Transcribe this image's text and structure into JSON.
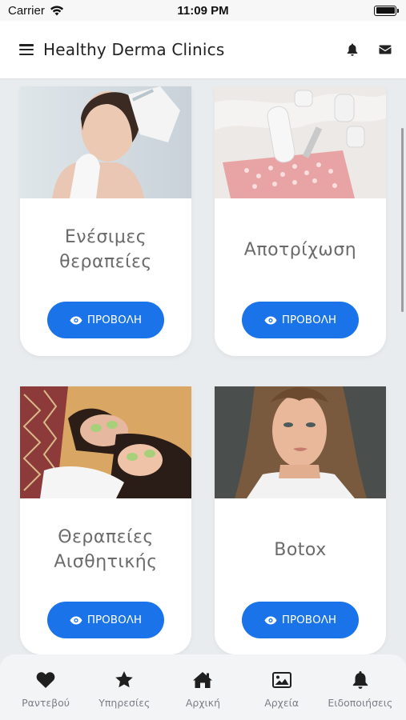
{
  "status_bar": {
    "carrier": "Carrier",
    "time": "11:09 PM"
  },
  "header": {
    "title": "Healthy Derma Clinics"
  },
  "cards": [
    {
      "title": "Ενέσιμες θεραπείες",
      "button_label": "ΠΡΟΒΟΛΗ"
    },
    {
      "title": "Αποτρίχωση",
      "button_label": "ΠΡΟΒΟΛΗ"
    },
    {
      "title": "Θεραπείες Αισθητικής",
      "button_label": "ΠΡΟΒΟΛΗ"
    },
    {
      "title": "Botox",
      "button_label": "ΠΡΟΒΟΛΗ"
    }
  ],
  "bottom_nav": [
    {
      "label": "Ραντεβού",
      "icon": "heart-icon"
    },
    {
      "label": "Υπηρεσίες",
      "icon": "star-icon"
    },
    {
      "label": "Αρχική",
      "icon": "home-icon"
    },
    {
      "label": "Αρχεία",
      "icon": "image-icon"
    },
    {
      "label": "Ειδοποιήσεις",
      "icon": "bell-icon"
    }
  ],
  "colors": {
    "accent": "#1a73e8",
    "nav_icon": "#1f1f1f",
    "nav_label": "#7b7f85",
    "background": "#e9ecee"
  }
}
